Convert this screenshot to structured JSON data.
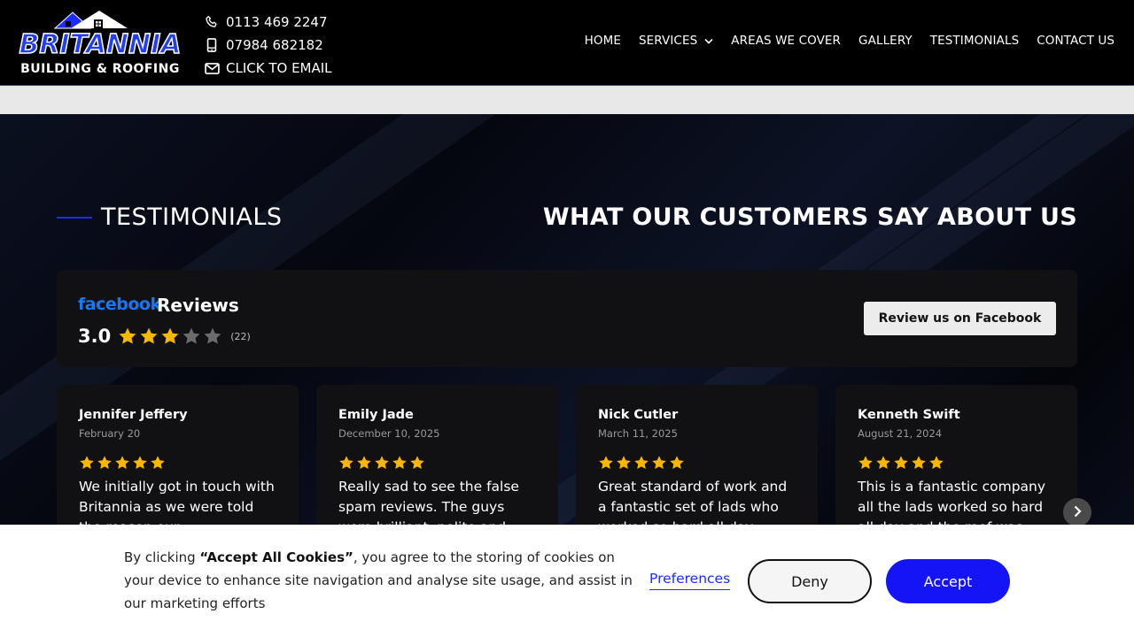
{
  "header": {
    "logo": {
      "brand": "BRITANNIA",
      "sub": "BUILDING & ROOFING"
    },
    "contacts": [
      {
        "icon": "phone-icon",
        "text": "0113 469 2247"
      },
      {
        "icon": "mobile-icon",
        "text": "07984 682182"
      },
      {
        "icon": "envelope-icon",
        "text": "CLICK TO EMAIL"
      }
    ],
    "nav": [
      {
        "label": "HOME"
      },
      {
        "label": "SERVICES",
        "has_dropdown": true
      },
      {
        "label": "AREAS WE COVER"
      },
      {
        "label": "GALLERY"
      },
      {
        "label": "TESTIMONIALS"
      },
      {
        "label": "CONTACT US"
      }
    ]
  },
  "section": {
    "label": "TESTIMONIALS",
    "heading": "WHAT OUR CUSTOMERS SAY ABOUT US"
  },
  "summary": {
    "source": "facebook",
    "title": "Reviews",
    "score": "3.0",
    "stars": 3,
    "count": "(22)",
    "button": "Review us on Facebook"
  },
  "reviews": [
    {
      "name": "Jennifer Jeffery",
      "date": "February 20",
      "stars": 5,
      "text": "We initially got in touch with Britannia as we were told the reason our"
    },
    {
      "name": "Emily Jade",
      "date": "December 10, 2025",
      "stars": 5,
      "text": "Really sad to see the false spam reviews. The guys were brilliant, polite and"
    },
    {
      "name": "Nick Cutler",
      "date": "March 11, 2025",
      "stars": 5,
      "text": "Great standard of work and a fantastic set of lads who worked so hard all day"
    },
    {
      "name": "Kenneth Swift",
      "date": "August 21, 2024",
      "stars": 5,
      "text": "This is a fantastic company all the lads worked so hard all day and the roof was"
    }
  ],
  "cookie": {
    "prefix": "By clicking ",
    "bold": "“Accept All Cookies”",
    "suffix": ", you agree to the storing of cookies on your device to enhance site navigation and analyse site usage, and assist in our marketing efforts",
    "preferences": "Preferences",
    "deny": "Deny",
    "accept": "Accept"
  },
  "colors": {
    "accent": "#1414f5",
    "facebook": "#1877f2",
    "star": "#f6b700",
    "star_empty": "#6b6b6b"
  }
}
